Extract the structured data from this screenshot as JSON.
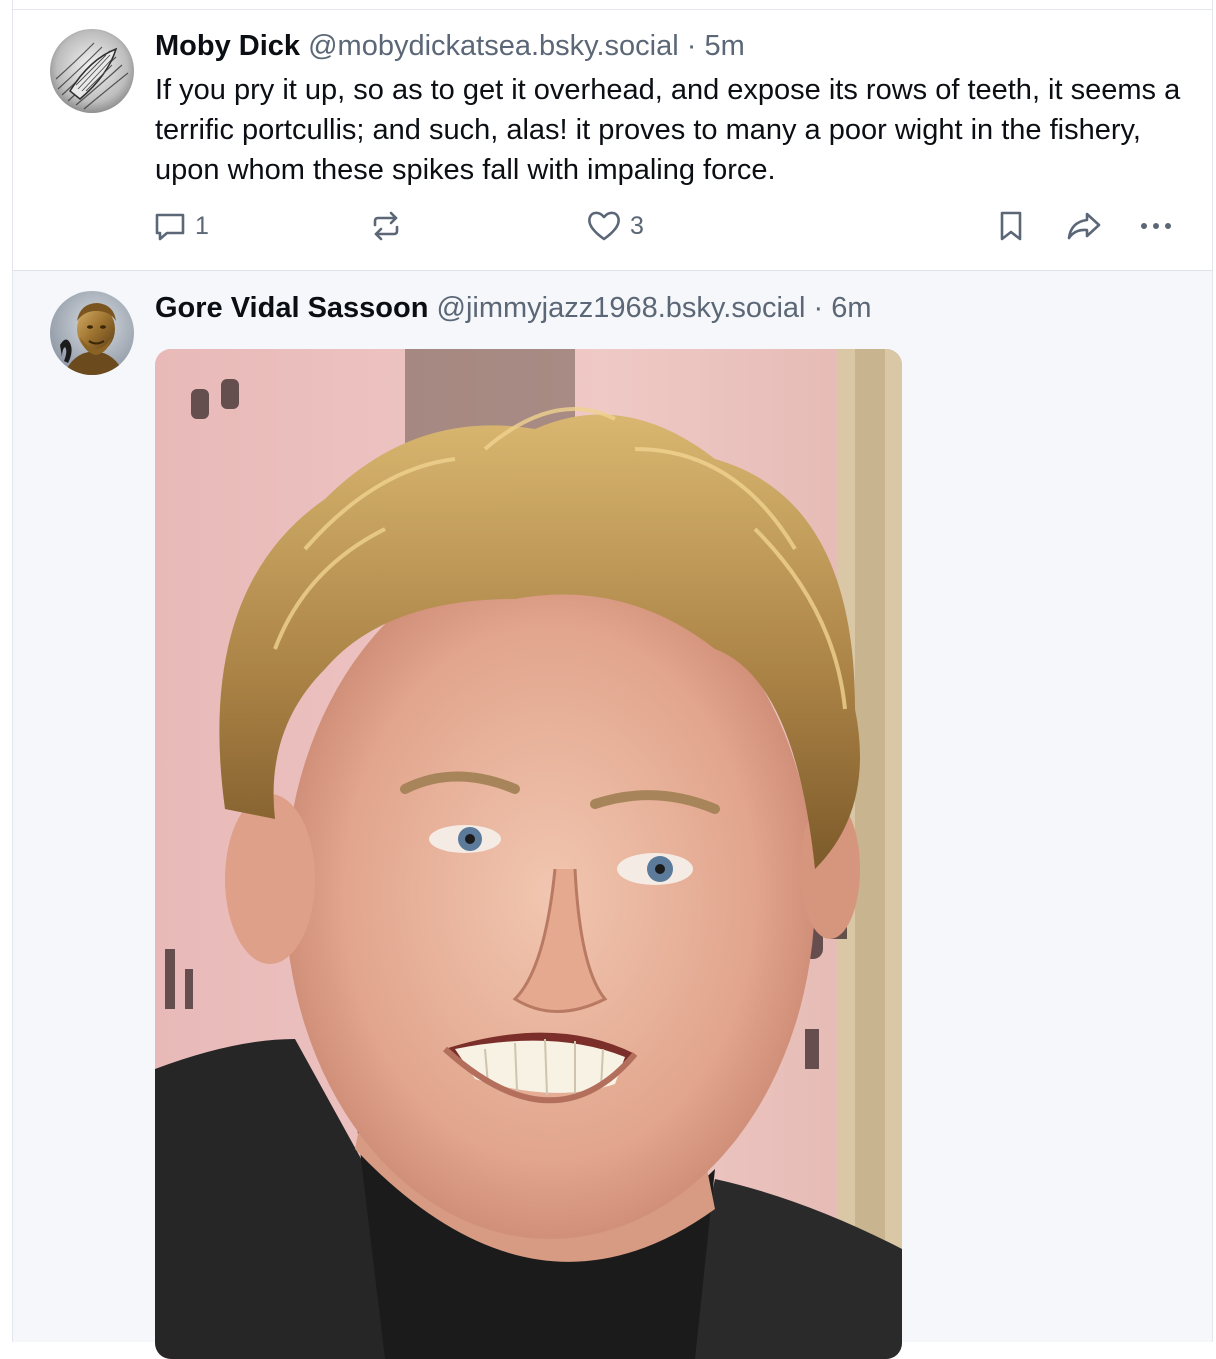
{
  "feed": {
    "posts": [
      {
        "author": {
          "display_name": "Moby Dick",
          "handle": "@mobydickatsea.bsky.social",
          "avatar_icon": "whale-engraving-avatar"
        },
        "separator": "·",
        "time": "5m",
        "text": "If you pry it up, so as to get it overhead, and expose its rows of teeth, it seems a terrific portcullis; and such, alas! it proves to many a poor wight in the fishery, upon whom these spikes fall with impaling force.",
        "actions": {
          "reply_count": "1",
          "repost_count": "",
          "like_count": "3"
        }
      },
      {
        "author": {
          "display_name": "Gore Vidal Sassoon",
          "handle": "@jimmyjazz1968.bsky.social",
          "avatar_icon": "statue-bust-avatar"
        },
        "separator": "·",
        "time": "6m",
        "embed": {
          "type": "image",
          "description_icon": "photo-smiling-man"
        }
      }
    ]
  },
  "colors": {
    "text_primary": "#0b0f14",
    "text_secondary": "#5b6776",
    "highlighted_post_bg": "#f5f7fa",
    "divider": "#dfe3e8"
  }
}
